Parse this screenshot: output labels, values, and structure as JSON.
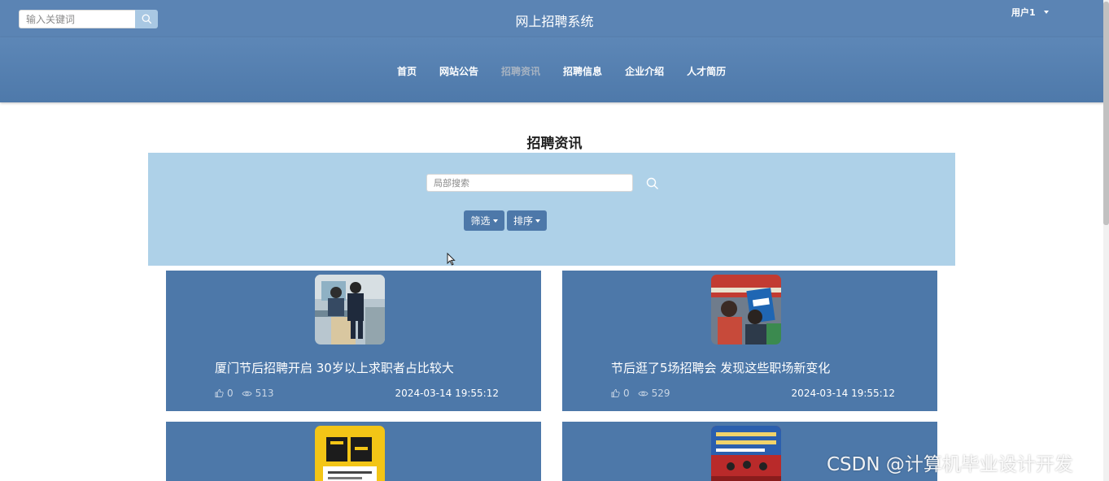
{
  "header": {
    "search_placeholder": "输入关键词",
    "site_title": "网上招聘系统",
    "user_label": "用户1"
  },
  "nav": {
    "items": [
      {
        "label": "首页",
        "active": false
      },
      {
        "label": "网站公告",
        "active": false
      },
      {
        "label": "招聘资讯",
        "active": true
      },
      {
        "label": "招聘信息",
        "active": false
      },
      {
        "label": "企业介绍",
        "active": false
      },
      {
        "label": "人才简历",
        "active": false
      }
    ]
  },
  "page": {
    "section_title": "招聘资讯",
    "local_search_placeholder": "局部搜索",
    "filter_label": "筛选",
    "sort_label": "排序"
  },
  "news": [
    {
      "title": "厦门节后招聘开启 30岁以上求职者占比较大",
      "likes": "0",
      "views": "513",
      "time": "2024-03-14 19:55:12",
      "image": "office-interview-photo"
    },
    {
      "title": "节后逛了5场招聘会 发现这些职场新变化",
      "likes": "0",
      "views": "529",
      "time": "2024-03-14 19:55:12",
      "image": "job-fair-photo"
    },
    {
      "title": "",
      "likes": "",
      "views": "",
      "time": "",
      "image": "recruitment-poster"
    },
    {
      "title": "",
      "likes": "",
      "views": "",
      "time": "",
      "image": "livestream-stage-photo"
    }
  ],
  "watermark": "CSDN @计算机毕业设计开发",
  "colors": {
    "topbar": "#5b84b4",
    "card": "#4d78a9",
    "panel": "#aed1e8"
  }
}
